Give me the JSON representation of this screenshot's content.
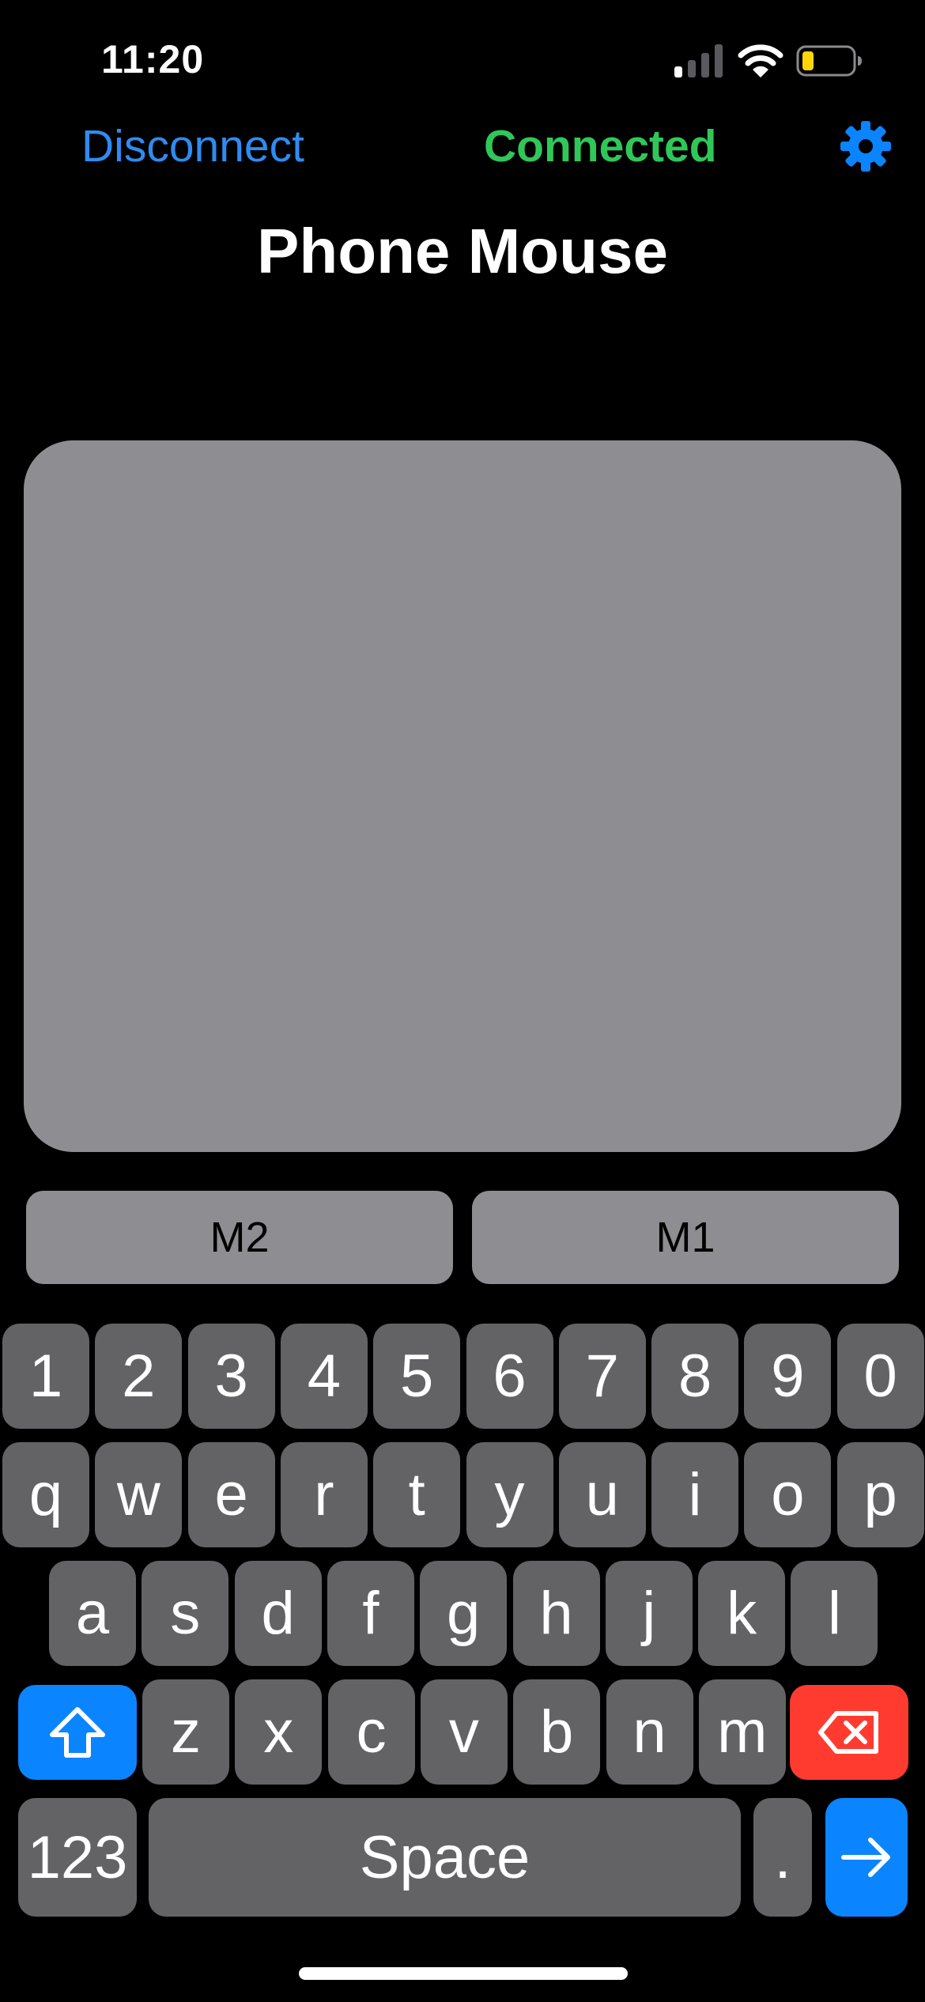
{
  "status_bar": {
    "time": "11:20"
  },
  "header": {
    "disconnect_label": "Disconnect",
    "connection_status": "Connected",
    "settings_icon": "gear-icon"
  },
  "title": "Phone Mouse",
  "mouse_buttons": {
    "left_label": "M2",
    "right_label": "M1"
  },
  "keyboard": {
    "number_row": [
      "1",
      "2",
      "3",
      "4",
      "5",
      "6",
      "7",
      "8",
      "9",
      "0"
    ],
    "row_1": [
      "q",
      "w",
      "e",
      "r",
      "t",
      "y",
      "u",
      "i",
      "o",
      "p"
    ],
    "row_2": [
      "a",
      "s",
      "d",
      "f",
      "g",
      "h",
      "j",
      "k",
      "l"
    ],
    "row_3": [
      "z",
      "x",
      "c",
      "v",
      "b",
      "n",
      "m"
    ],
    "shift_icon": "shift-icon",
    "delete_icon": "delete-icon",
    "mode_label": "123",
    "space_label": "Space",
    "period_label": ".",
    "enter_icon": "arrow-right-icon"
  },
  "colors": {
    "background": "#000000",
    "accent_blue": "#0b84ff",
    "link_blue": "#2f8bf0",
    "connected_green": "#30c759",
    "trackpad_gray": "#8e8d92",
    "key_gray": "#636366",
    "delete_red": "#ff3b30",
    "battery_yellow": "#ffd60a"
  }
}
